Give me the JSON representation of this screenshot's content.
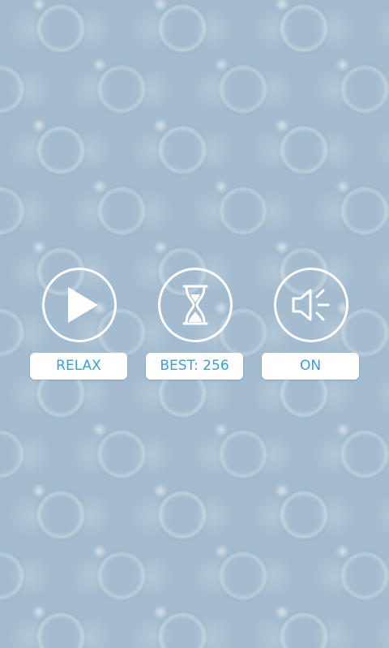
{
  "menu": {
    "relax_label": "RELAX",
    "best_label": "BEST: 256",
    "sound_label": "ON"
  },
  "icons": {
    "play": "play-icon",
    "timer": "hourglass-icon",
    "sound": "speaker-icon"
  },
  "colors": {
    "label_text": "#3a9fd6",
    "label_bg": "#ffffff",
    "icon_stroke": "#ffffff",
    "background": "#a3bccf"
  }
}
